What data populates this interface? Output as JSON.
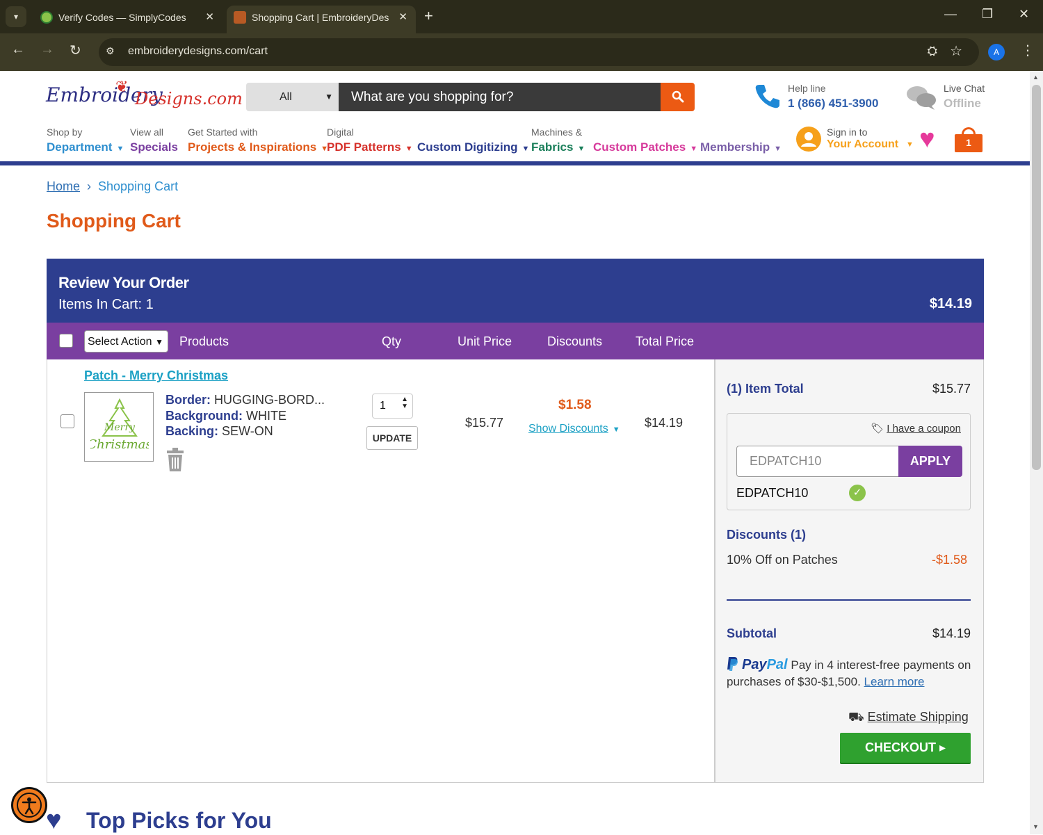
{
  "browser": {
    "tabs": [
      {
        "title": "Verify Codes — SimplyCodes",
        "active": false
      },
      {
        "title": "Shopping Cart | EmbroideryDes",
        "active": true
      }
    ],
    "url": "embroiderydesigns.com/cart",
    "profile_initial": "A"
  },
  "header": {
    "logo_part1": "Embroidery",
    "logo_part2": "Designs.com",
    "search": {
      "category": "All",
      "placeholder": "What are you shopping for?"
    },
    "helpline": {
      "label": "Help line",
      "value": "1 (866) 451-3900"
    },
    "livechat": {
      "label": "Live Chat",
      "value": "Offline"
    },
    "nav": [
      {
        "small": "Shop by",
        "big": "Department",
        "color": "#2f8fcf",
        "caret": true
      },
      {
        "small": "View all",
        "big": "Specials",
        "color": "#7a3fa0",
        "caret": false
      },
      {
        "small": "Get Started with",
        "big": "Projects & Inspirations",
        "color": "#e05a1a",
        "caret": true
      },
      {
        "small": "Digital",
        "big": "PDF Patterns",
        "color": "#d6312b",
        "caret": true
      },
      {
        "small": "",
        "big": "Custom Digitizing",
        "color": "#2d3e8f",
        "caret": true
      },
      {
        "small": "Machines &",
        "big": "Fabrics",
        "color": "#1a7f5a",
        "caret": true
      },
      {
        "small": "",
        "big": "Custom Patches",
        "color": "#d63a9b",
        "caret": true
      },
      {
        "small": "",
        "big": "Membership",
        "color": "#7a5fa8",
        "caret": true
      }
    ],
    "account": {
      "small": "Sign in to",
      "big": "Your Account"
    },
    "cart_count": "1"
  },
  "breadcrumb": {
    "home": "Home",
    "current": "Shopping Cart"
  },
  "page_title": "Shopping Cart",
  "review": {
    "title": "Review Your Order",
    "items_label": "Items In Cart: 1",
    "total": "$14.19"
  },
  "columns": {
    "select_action": "Select Action",
    "products": "Products",
    "qty": "Qty",
    "unit_price": "Unit Price",
    "discounts": "Discounts",
    "total_price": "Total Price"
  },
  "item": {
    "name": "Patch - Merry Christmas",
    "border_label": "Border:",
    "border_value": "HUGGING-BORD...",
    "background_label": "Background:",
    "background_value": "WHITE",
    "backing_label": "Backing:",
    "backing_value": "SEW-ON",
    "qty": "1",
    "update_label": "UPDATE",
    "unit_price": "$15.77",
    "discount": "$1.58",
    "show_discounts": "Show Discounts",
    "total_price": "$14.19"
  },
  "summary": {
    "item_total_label": "(1) Item Total",
    "item_total_value": "$15.77",
    "have_coupon": "I have a coupon",
    "coupon_input": "EDPATCH10",
    "apply_label": "APPLY",
    "applied_code": "EDPATCH10",
    "discounts_label": "Discounts (1)",
    "discount_line_label": "10% Off on Patches",
    "discount_line_value": "-$1.58",
    "subtotal_label": "Subtotal",
    "subtotal_value": "$14.19",
    "paypal_brand1": "Pay",
    "paypal_brand2": "Pal",
    "paypal_text": "Pay in 4 interest-free payments on purchases of $30-$1,500.",
    "paypal_learn": "Learn more",
    "estimate_shipping": "Estimate Shipping",
    "checkout_label": "CHECKOUT"
  },
  "top_picks": "Top Picks for You",
  "colors": {
    "navy": "#2d3e8f",
    "purple": "#7a3fa0",
    "orange": "#e05a1a",
    "checkout_green": "#2fa12f"
  }
}
